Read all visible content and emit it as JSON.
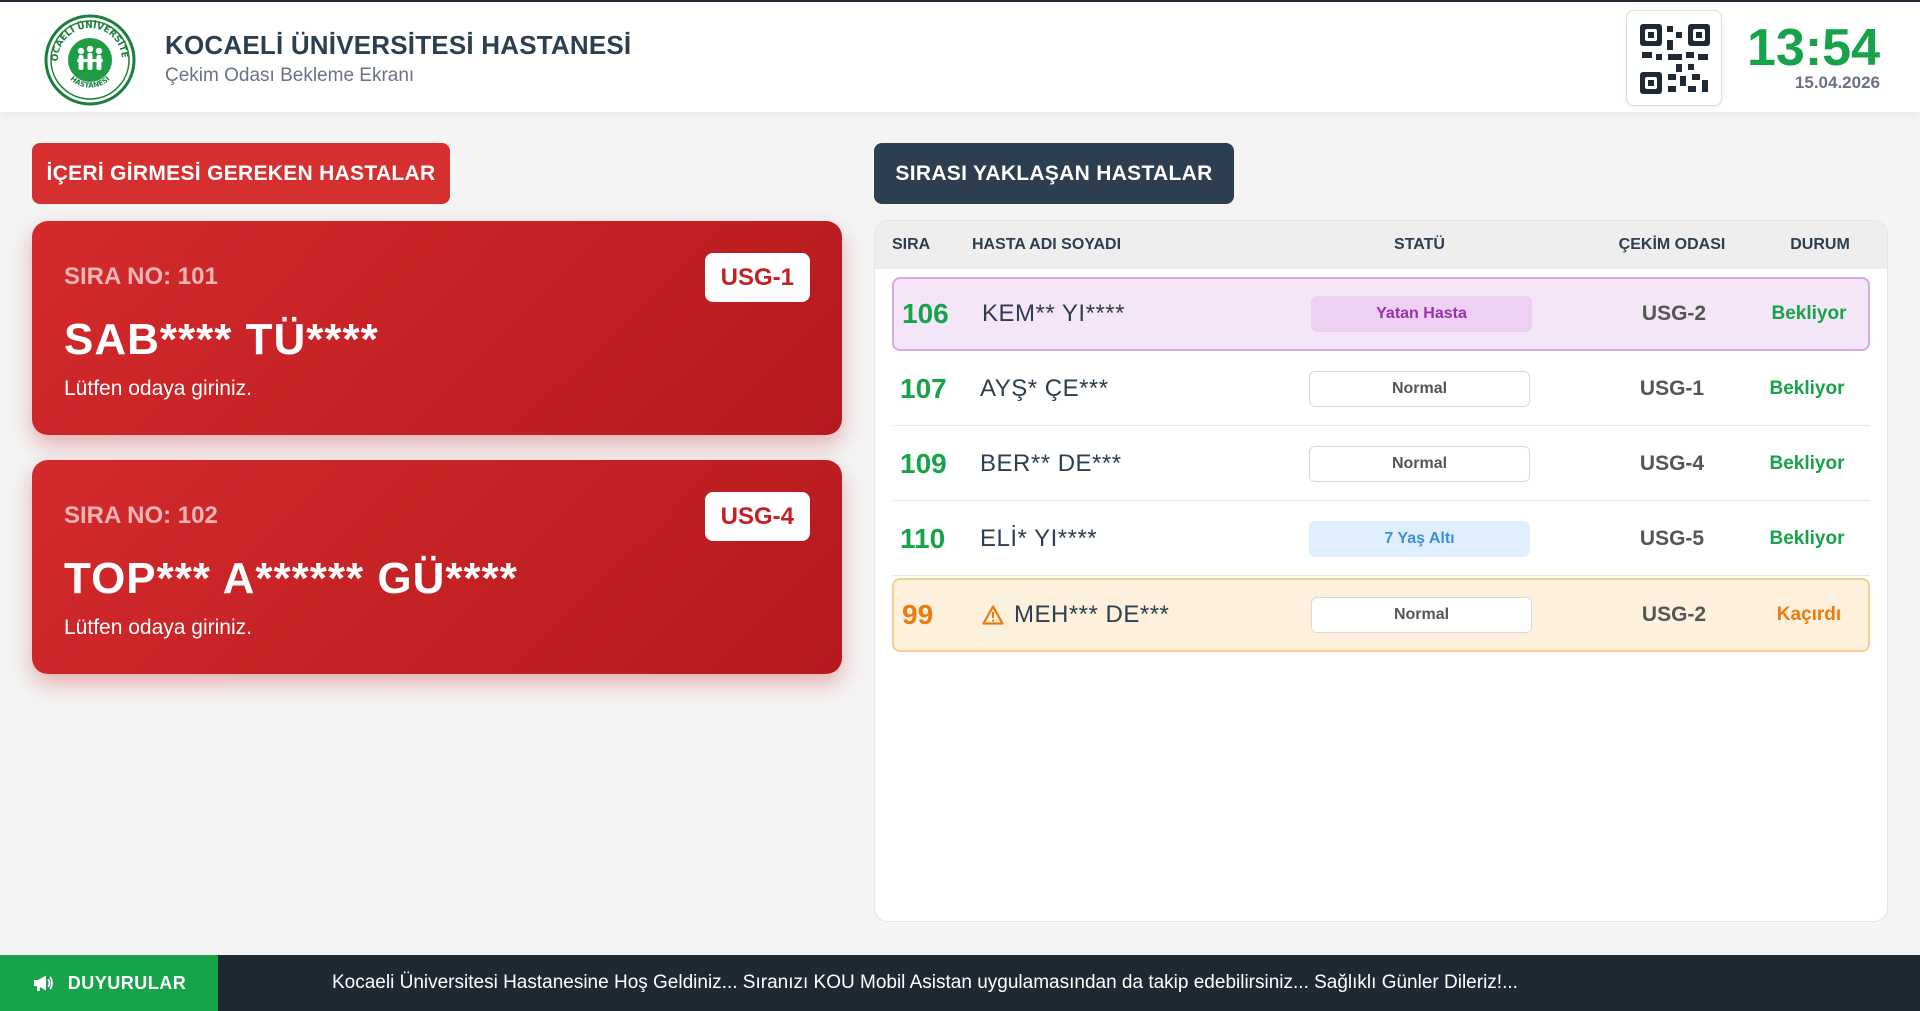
{
  "header": {
    "title": "KOCAELİ ÜNİVERSİTESİ HASTANESİ",
    "subtitle": "Çekim Odası Bekleme Ekranı",
    "logo_text_top": "KOCAELİ ÜNİVERSİTESİ",
    "logo_text_bottom": "HASTANESİ",
    "time": "13:54",
    "date": "15.04.2026",
    "logo_icon": "hospital-logo-icon",
    "qr_icon": "qr-code-icon"
  },
  "left_section": {
    "title": "İÇERİ GİRMESİ GEREKEN HASTALAR",
    "cards": [
      {
        "sira": "SIRA NO: 101",
        "room": "USG-1",
        "name": "SAB**** TÜ****",
        "message": "Lütfen odaya giriniz."
      },
      {
        "sira": "SIRA NO: 102",
        "room": "USG-4",
        "name": "TOP*** A****** GÜ****",
        "message": "Lütfen odaya giriniz."
      }
    ]
  },
  "right_section": {
    "title": "SIRASI YAKLAŞAN HASTALAR",
    "columns": {
      "sira": "SIRA",
      "name": "HASTA ADI SOYADI",
      "status": "STATÜ",
      "room": "ÇEKİM ODASI",
      "state": "DURUM"
    },
    "rows": [
      {
        "no": "106",
        "name": "KEM** YI****",
        "status": "Yatan Hasta",
        "room": "USG-2",
        "state": "Bekliyor"
      },
      {
        "no": "107",
        "name": "AYŞ* ÇE***",
        "status": "Normal",
        "room": "USG-1",
        "state": "Bekliyor"
      },
      {
        "no": "109",
        "name": "BER** DE***",
        "status": "Normal",
        "room": "USG-4",
        "state": "Bekliyor"
      },
      {
        "no": "110",
        "name": "ELİ* YI****",
        "status": "7 Yaş Altı",
        "room": "USG-5",
        "state": "Bekliyor"
      },
      {
        "no": "99",
        "name": "MEH*** DE***",
        "status": "Normal",
        "room": "USG-2",
        "state": "Kaçırdı"
      }
    ]
  },
  "footer": {
    "label": "DUYURULAR",
    "ticker": "Kocaeli Üniversitesi Hastanesine Hoş Geldiniz...  Sıranızı KOU Mobil Asistan uygulamasından da takip edebilirsiniz... Sağlıklı Günler Dileriz!..."
  },
  "colors": {
    "accent_red": "#d62f30",
    "accent_green": "#16a34a",
    "accent_navy": "#2c3e50",
    "accent_orange": "#ea7b0c",
    "accent_purple": "#9b2fae"
  }
}
